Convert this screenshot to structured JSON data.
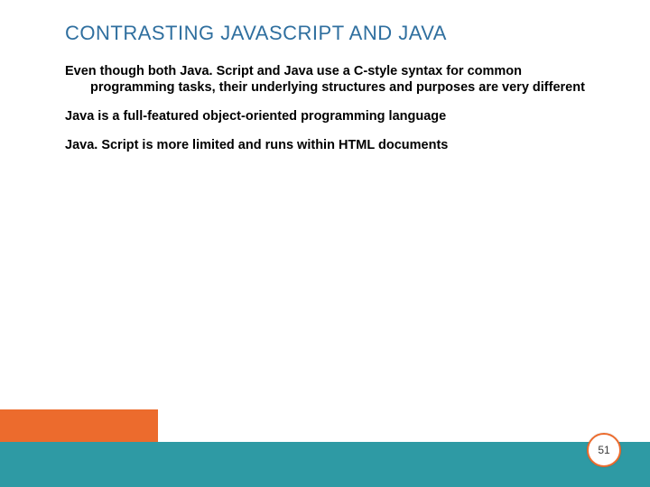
{
  "slide": {
    "title": "CONTRASTING JAVASCRIPT AND JAVA",
    "paragraphs": {
      "p1_line1": "Even though both Java. Script and Java use a C-style syntax for common",
      "p1_cont": "programming tasks, their underlying structures and purposes are very different",
      "p2": "Java is a full-featured object-oriented programming language",
      "p3": "Java. Script is more limited and runs within HTML documents"
    },
    "page_number": "51"
  }
}
